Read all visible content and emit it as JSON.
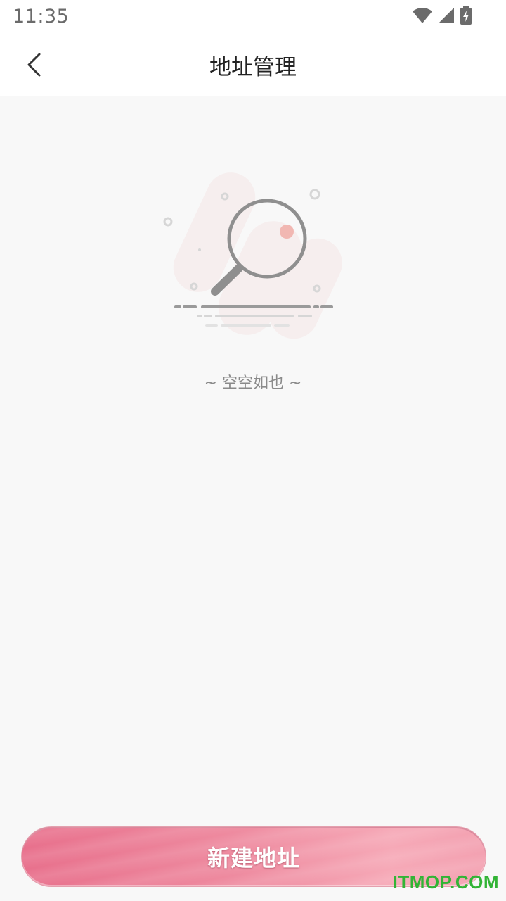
{
  "status_bar": {
    "time": "11:35",
    "icons": [
      "wifi-icon",
      "signal-icon",
      "battery-charging-icon"
    ]
  },
  "header": {
    "back_icon": "chevron-left-icon",
    "title": "地址管理"
  },
  "empty_state": {
    "illustration": "magnifier-empty-illustration",
    "message": "~ 空空如也 ~"
  },
  "footer": {
    "new_address_label": "新建地址"
  },
  "watermark": "ITMOP.COM",
  "colors": {
    "background": "#f8f8f8",
    "header_bg": "#ffffff",
    "button_start": "#e8708c",
    "button_end": "#f6a9b7",
    "accent_dot": "#f2b9b6",
    "watermark": "#32b436"
  }
}
